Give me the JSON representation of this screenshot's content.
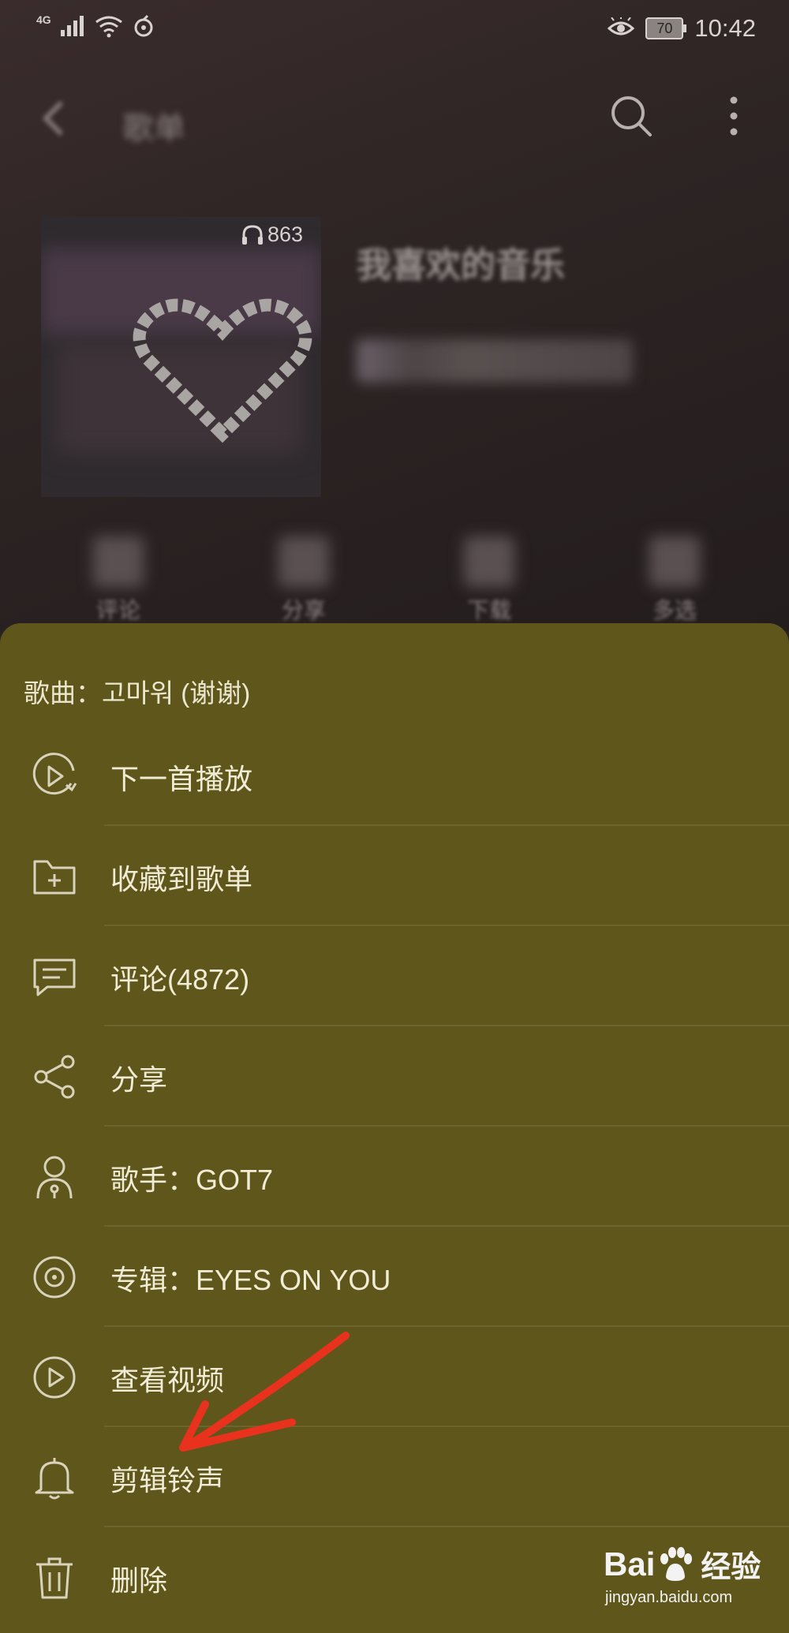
{
  "status_bar": {
    "network": "4G",
    "battery": "70",
    "time": "10:42"
  },
  "header": {
    "title": "歌单"
  },
  "playlist": {
    "play_count": "863",
    "name": "我喜欢的音乐"
  },
  "actions": [
    {
      "label": "评论"
    },
    {
      "label": "分享"
    },
    {
      "label": "下载"
    },
    {
      "label": "多选"
    }
  ],
  "sheet": {
    "title": "歌曲：고마워 (谢谢)",
    "items": [
      {
        "label": "下一首播放",
        "icon": "play-next-icon"
      },
      {
        "label": "收藏到歌单",
        "icon": "folder-add-icon"
      },
      {
        "label": "评论(4872)",
        "icon": "comment-icon"
      },
      {
        "label": "分享",
        "icon": "share-icon"
      },
      {
        "label": "歌手：GOT7",
        "icon": "singer-icon"
      },
      {
        "label": "专辑：EYES ON YOU",
        "icon": "album-icon"
      },
      {
        "label": "查看视频",
        "icon": "video-icon"
      },
      {
        "label": "剪辑铃声",
        "icon": "bell-icon"
      },
      {
        "label": "删除",
        "icon": "trash-icon"
      }
    ]
  },
  "watermark": {
    "logo_a": "Bai",
    "logo_b": "经验",
    "url": "jingyan.baidu.com"
  },
  "colors": {
    "sheet_bg": "#5f561b",
    "annotation_arrow": "#e8321e"
  }
}
